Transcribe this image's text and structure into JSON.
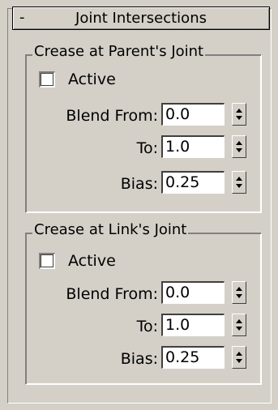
{
  "rollout": {
    "collapse_symbol": "-",
    "title": "Joint Intersections"
  },
  "groups": [
    {
      "legend": "Crease at Parent's Joint",
      "active_label": "Active",
      "active_checked": false,
      "blend_from_label": "Blend From:",
      "blend_from_value": "0.0",
      "to_label": "To:",
      "to_value": "1.0",
      "bias_label": "Bias:",
      "bias_value": "0.25"
    },
    {
      "legend": "Crease at Link's Joint",
      "active_label": "Active",
      "active_checked": false,
      "blend_from_label": "Blend From:",
      "blend_from_value": "0.0",
      "to_label": "To:",
      "to_value": "1.0",
      "bias_label": "Bias:",
      "bias_value": "0.25"
    }
  ],
  "icons": {
    "spinner": "up-down-arrows-icon"
  },
  "colors": {
    "panel_bg": "#d4d0c8"
  }
}
